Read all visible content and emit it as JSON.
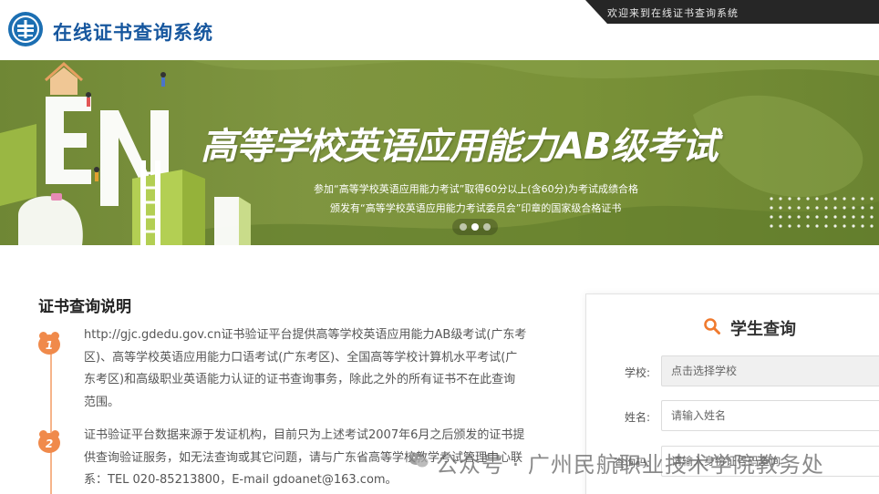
{
  "header": {
    "site_title": "在线证书查询系统",
    "welcome_text": "欢迎来到在线证书查询系统",
    "logo_icon": "emblem-logo-icon"
  },
  "banner": {
    "title": "高等学校英语应用能力AB级考试",
    "subtitle_line1": "参加“高等学校英语应用能力考试”取得60分以上(含60分)为考试成绩合格",
    "subtitle_line2": "颁发有“高等学校英语应用能力考试委员会”印章的国家级合格证书",
    "slides_count": 3,
    "active_slide": 2,
    "background_color": "#7a9238"
  },
  "intro": {
    "title": "证书查询说明",
    "steps": [
      {
        "number": "1",
        "text": "http://gjc.gdedu.gov.cn证书验证平台提供高等学校英语应用能力AB级考试(广东考区)、高等学校英语应用能力口语考试(广东考区)、全国高等学校计算机水平考试(广东考区)和高级职业英语能力认证的证书查询事务，除此之外的所有证书不在此查询范围。"
      },
      {
        "number": "2",
        "text": "证书验证平台数据来源于发证机构，目前只为上述考试2007年6月之后颁发的证书提供查询验证服务，如无法查询或其它问题，请与广东省高等学校教学考试管理中心联系：TEL 020-85213800，E-mail gdoanet@163.com。"
      }
    ],
    "accent_color": "#f08a4b"
  },
  "student_query": {
    "title": "学生查询",
    "icon": "search-icon",
    "fields": {
      "school": {
        "label": "学校:",
        "placeholder": "点击选择学校"
      },
      "name": {
        "label": "姓名:",
        "placeholder": "请输入姓名"
      },
      "id": {
        "label": "查询码:",
        "placeholder": "请输入身份证号码查询"
      }
    }
  },
  "watermark": {
    "text": "公众号 · 广州民航职业技术学院教务处",
    "icon": "wechat-icon"
  }
}
